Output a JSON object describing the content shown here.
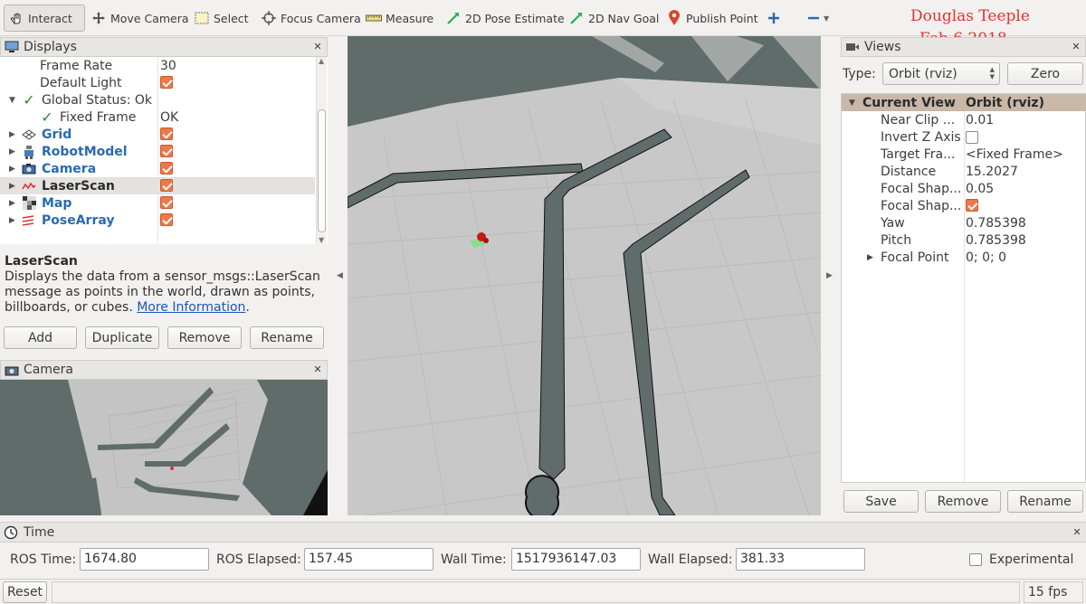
{
  "toolbar": {
    "interact": "Interact",
    "move_camera": "Move Camera",
    "select": "Select",
    "focus_camera": "Focus Camera",
    "measure": "Measure",
    "pose_estimate": "2D Pose Estimate",
    "nav_goal": "2D Nav Goal",
    "publish_point": "Publish Point"
  },
  "signature": {
    "name": "Douglas Teeple",
    "date": "Feb 6 2018",
    "color": "#e0332e"
  },
  "displays": {
    "title": "Displays",
    "rows": [
      {
        "name": "Frame Rate",
        "value": "30"
      },
      {
        "name": "Default Light"
      },
      {
        "name": "Global Status: Ok"
      },
      {
        "name": "Fixed Frame",
        "value": "OK"
      },
      {
        "name": "Grid"
      },
      {
        "name": "RobotModel"
      },
      {
        "name": "Camera"
      },
      {
        "name": "LaserScan"
      },
      {
        "name": "Map"
      },
      {
        "name": "PoseArray"
      }
    ],
    "desc_title": "LaserScan",
    "desc_text": "Displays the data from a sensor_msgs::LaserScan message as points in the world, drawn as points, billboards, or cubes.",
    "desc_link": "More Information",
    "desc_end": ".",
    "buttons": {
      "add": "Add",
      "duplicate": "Duplicate",
      "remove": "Remove",
      "rename": "Rename"
    }
  },
  "camera": {
    "title": "Camera"
  },
  "views": {
    "title": "Views",
    "type_label": "Type:",
    "type_value": "Orbit (rviz)",
    "zero": "Zero",
    "header_name": "Current View",
    "header_value": "Orbit (rviz)",
    "rows": [
      {
        "name": "Near Clip ...",
        "value": "0.01"
      },
      {
        "name": "Invert Z Axis"
      },
      {
        "name": "Target Fra...",
        "value": "<Fixed Frame>"
      },
      {
        "name": "Distance",
        "value": "15.2027"
      },
      {
        "name": "Focal Shap...",
        "value": "0.05"
      },
      {
        "name": "Focal Shap..."
      },
      {
        "name": "Yaw",
        "value": "0.785398"
      },
      {
        "name": "Pitch",
        "value": "0.785398"
      },
      {
        "name": "Focal Point",
        "value": "0; 0; 0"
      }
    ],
    "buttons": {
      "save": "Save",
      "remove": "Remove",
      "rename": "Rename"
    }
  },
  "time": {
    "title": "Time",
    "ros_time_label": "ROS Time:",
    "ros_time": "1674.80",
    "ros_elapsed_label": "ROS Elapsed:",
    "ros_elapsed": "157.45",
    "wall_time_label": "Wall Time:",
    "wall_time": "1517936147.03",
    "wall_elapsed_label": "Wall Elapsed:",
    "wall_elapsed": "381.33",
    "experimental": "Experimental"
  },
  "status": {
    "reset": "Reset",
    "fps": "15 fps"
  },
  "colors": {
    "accent_check": "#f07746",
    "link_blue": "#2a6ab0",
    "floor": "#c8c8c8",
    "wall": "#5f6c69"
  }
}
